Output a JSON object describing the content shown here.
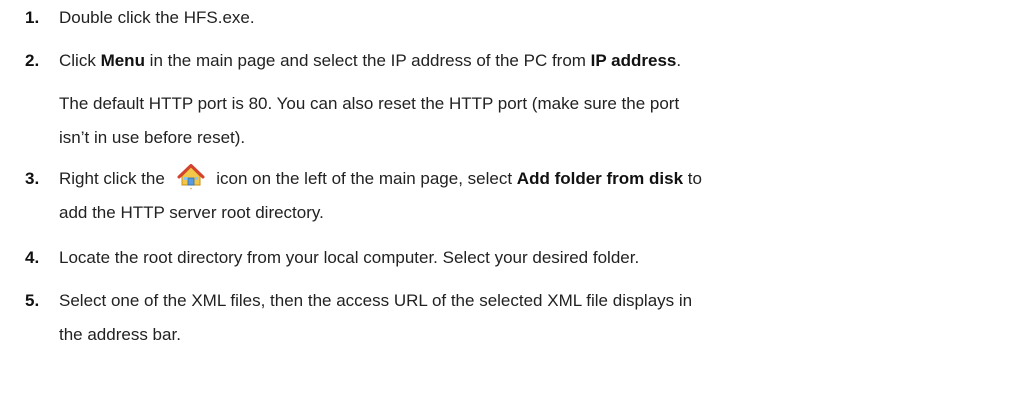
{
  "steps": [
    {
      "number": "1.",
      "text": "Double click the HFS.exe."
    },
    {
      "number": "2.",
      "pre": "Click ",
      "bold1": "Menu",
      "mid": " in the main page and select the IP address of the PC from ",
      "bold2": "IP address",
      "post": ".",
      "note_line1": "The default HTTP port is 80. You can also reset the HTTP port (make sure the port",
      "note_line2": "isn’t in use before reset)."
    },
    {
      "number": "3.",
      "pre": "Right click the",
      "icon": "home-folder-icon",
      "mid": "icon on the left of the main page, select ",
      "bold": "Add folder from disk",
      "post": " to",
      "line2": "add the HTTP server root directory."
    },
    {
      "number": "4.",
      "text": "Locate the root directory from your local computer. Select your desired folder."
    },
    {
      "number": "5.",
      "line1": "Select one of the XML files, then the access URL of the selected XML file displays in",
      "line2": "the address bar."
    }
  ]
}
